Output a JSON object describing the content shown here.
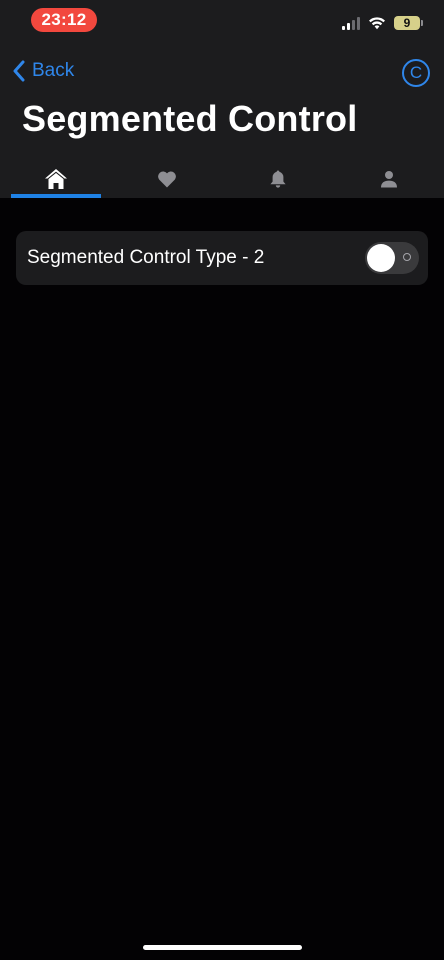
{
  "status_bar": {
    "time": "23:12",
    "battery_level": "9",
    "icons": [
      "signal-icon",
      "wifi-icon",
      "battery-icon"
    ]
  },
  "nav": {
    "back_label": "Back",
    "back_icon": "chevron-left-icon",
    "right_icon": "copyright-icon",
    "right_glyph": "C",
    "accent_color": "#2f86ea"
  },
  "page": {
    "title": "Segmented Control"
  },
  "tabs": {
    "selected_index": 0,
    "indicator_color": "#1f82e6",
    "items": [
      {
        "icon": "home-icon",
        "selected": true
      },
      {
        "icon": "heart-icon",
        "selected": false
      },
      {
        "icon": "bell-icon",
        "selected": false
      },
      {
        "icon": "person-icon",
        "selected": false
      }
    ]
  },
  "settings": {
    "rows": [
      {
        "label": "Segmented Control Type - 2",
        "toggle_on": false
      }
    ]
  }
}
